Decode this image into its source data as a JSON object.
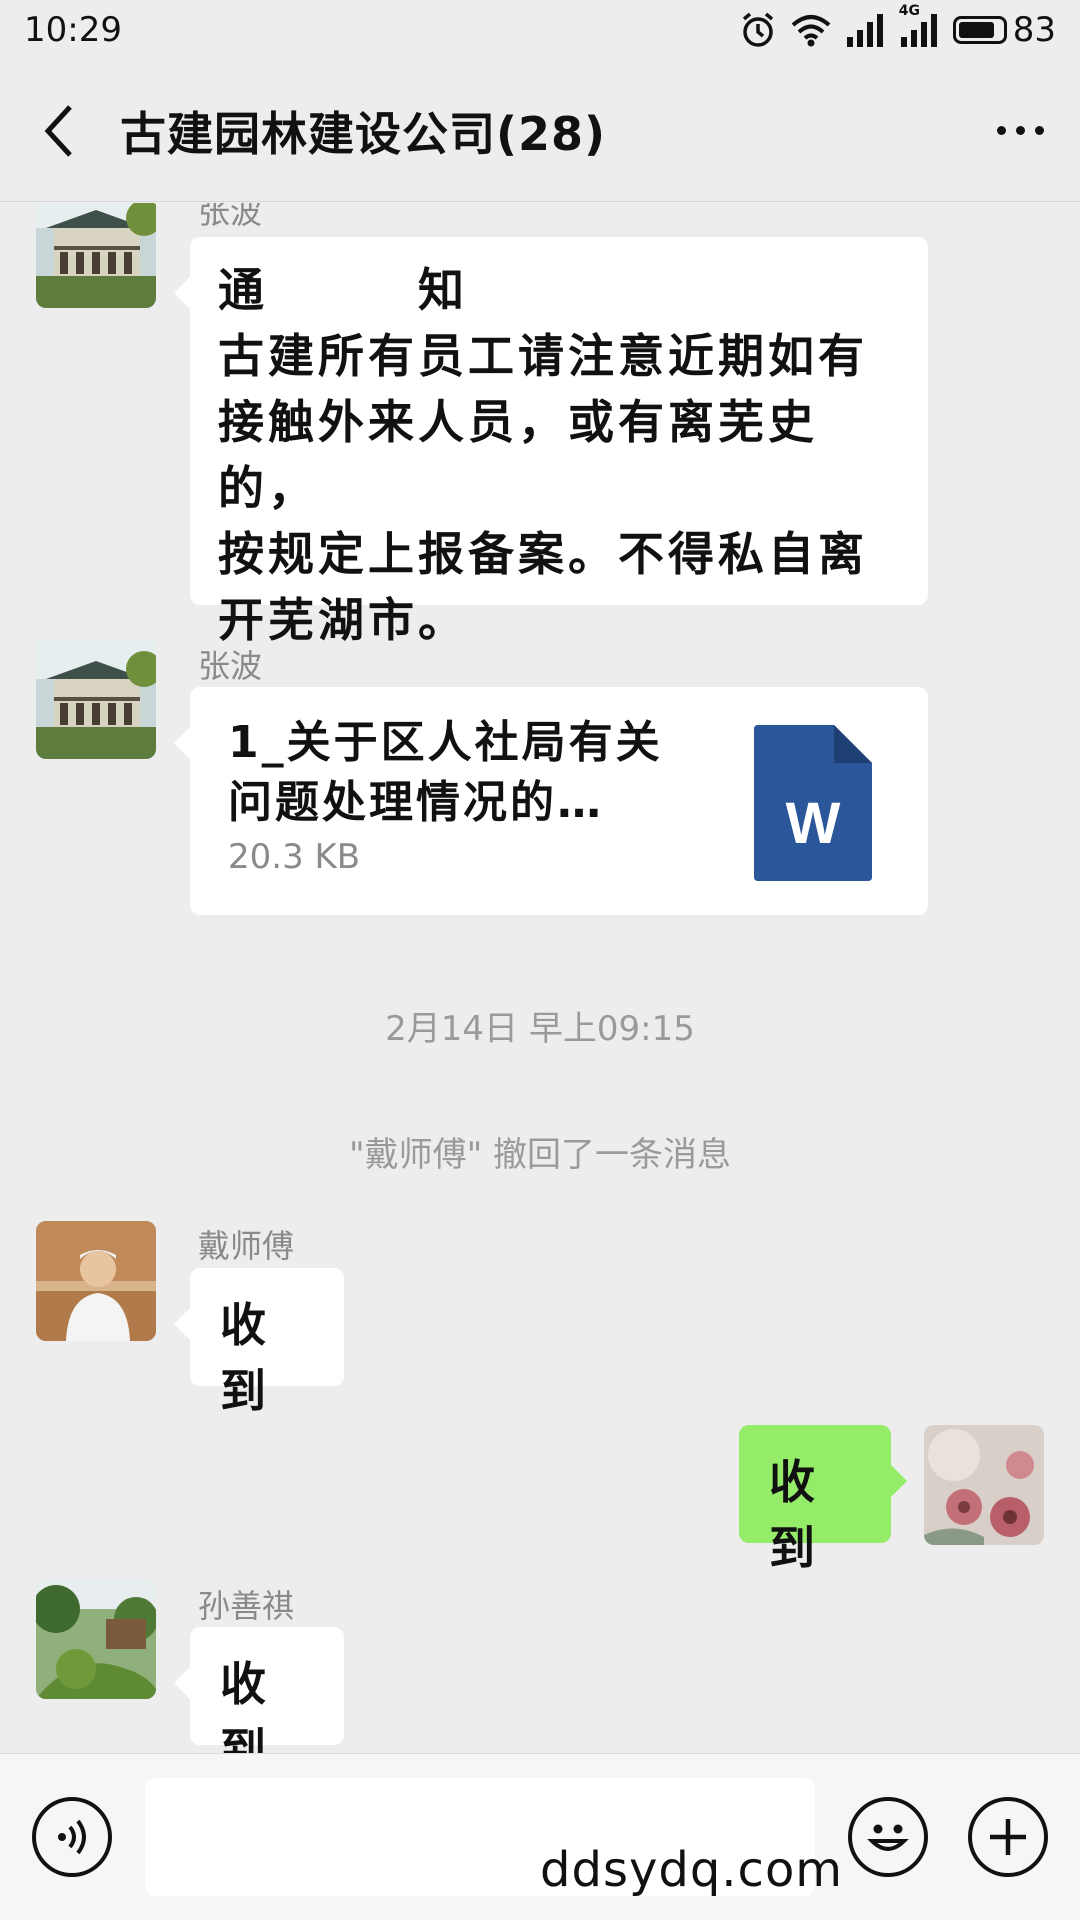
{
  "status_bar": {
    "time": "10:29",
    "network": "4G",
    "battery": "83",
    "battery_fraction": 0.83
  },
  "header": {
    "back_icon": "chevron-left-icon",
    "title": "古建园林建设公司(28)",
    "more_icon": "more-dots-icon"
  },
  "messages": [
    {
      "sender": "张波",
      "avatar": "building-avatar",
      "lines": [
        "通　　　知",
        "古建所有员工请注意近期如有",
        "接触外来人员，或有离芜史的，",
        "按规定上报备案。不得私自离",
        "开芜湖市。"
      ]
    },
    {
      "sender": "张波",
      "avatar": "building-avatar",
      "file": {
        "name_line1": "1_关于区人社局有关",
        "name_line2": "问题处理情况的…",
        "size": "20.3 KB",
        "icon": "word-document-icon",
        "icon_letter": "W"
      }
    },
    {
      "timestamp": "2月14日 早上09:15"
    },
    {
      "recall_notice": "\"戴师傅\" 撤回了一条消息"
    },
    {
      "sender": "戴师傅",
      "avatar": "person-avatar",
      "text": "收到"
    },
    {
      "self": true,
      "avatar": "flower-avatar",
      "text": "收到"
    },
    {
      "sender": "孙善祺",
      "avatar": "garden-avatar",
      "text": "收到"
    }
  ],
  "input_bar": {
    "voice_icon": "voice-icon",
    "input_value": "",
    "emoji_icon": "emoji-icon",
    "plus_icon": "plus-icon"
  },
  "watermark": "ddsydq.com",
  "colors": {
    "background": "#ededed",
    "self_bubble": "#95ec69",
    "word_blue": "#2b579a"
  }
}
